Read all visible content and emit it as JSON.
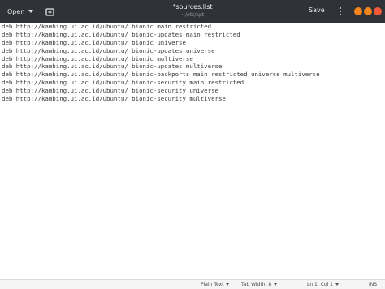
{
  "header": {
    "open_label": "Open",
    "title": "*sources.list",
    "subtitle": "~/etc/apt",
    "save_label": "Save"
  },
  "editor": {
    "lines": [
      "deb http://kambing.ui.ac.id/ubuntu/ bionic main restricted",
      "deb http://kambing.ui.ac.id/ubuntu/ bionic-updates main restricted",
      "deb http://kambing.ui.ac.id/ubuntu/ bionic universe",
      "deb http://kambing.ui.ac.id/ubuntu/ bionic-updates universe",
      "deb http://kambing.ui.ac.id/ubuntu/ bionic multiverse",
      "deb http://kambing.ui.ac.id/ubuntu/ bionic-updates multiverse",
      "deb http://kambing.ui.ac.id/ubuntu/ bionic-backports main restricted universe multiverse",
      "deb http://kambing.ui.ac.id/ubuntu/ bionic-security main restricted",
      "deb http://kambing.ui.ac.id/ubuntu/ bionic-security universe",
      "deb http://kambing.ui.ac.id/ubuntu/ bionic-security multiverse"
    ]
  },
  "statusbar": {
    "language": "Plain Text",
    "tab_width": "Tab Width: 8",
    "position": "Ln 1, Col 1",
    "mode": "INS"
  },
  "colors": {
    "headerbar": "#2f3237",
    "minimize": "#f3851c",
    "maximize": "#f3851c",
    "close": "#ef5a3a"
  }
}
